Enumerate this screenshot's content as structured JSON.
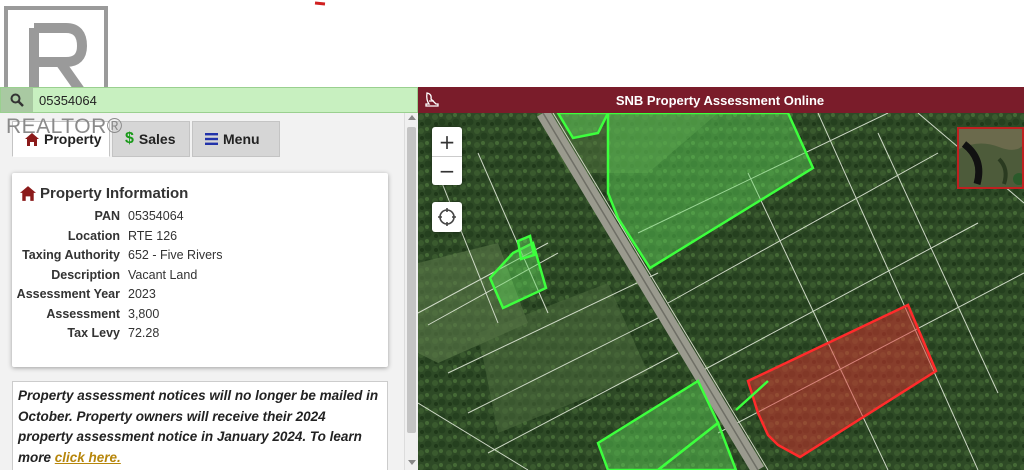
{
  "watermark": {
    "text": "REALTOR®"
  },
  "search": {
    "value": "05354064",
    "placeholder": ""
  },
  "header": {
    "title": "SNB Property Assessment Online"
  },
  "tabs": [
    {
      "label": "Property",
      "icon": "home-icon",
      "active": true
    },
    {
      "label": "Sales",
      "icon": "dollar-icon",
      "active": false
    },
    {
      "label": "Menu",
      "icon": "hamburger-icon",
      "active": false
    }
  ],
  "property_info": {
    "title": "Property Information",
    "rows": [
      {
        "label": "PAN",
        "value": "05354064"
      },
      {
        "label": "Location",
        "value": "RTE 126"
      },
      {
        "label": "Taxing Authority",
        "value": "652 - Five Rivers"
      },
      {
        "label": "Description",
        "value": "Vacant Land"
      },
      {
        "label": "Assessment Year",
        "value": "2023"
      },
      {
        "label": "Assessment",
        "value": "3,800"
      },
      {
        "label": "Tax Levy",
        "value": "72.28"
      }
    ]
  },
  "notice": {
    "text": "Property assessment notices will no longer be mailed in October. Property owners will receive their 2024 property assessment notice in January 2024. To learn more ",
    "link_label": "click here."
  },
  "map": {
    "zoom_in_label": "+",
    "zoom_out_label": "−"
  },
  "colors": {
    "header_bg": "#7a1c2a",
    "search_bg": "#c8f0c0",
    "selected_parcel": "#e03030",
    "other_parcels": "#44ff44",
    "link": "#b7860b"
  }
}
